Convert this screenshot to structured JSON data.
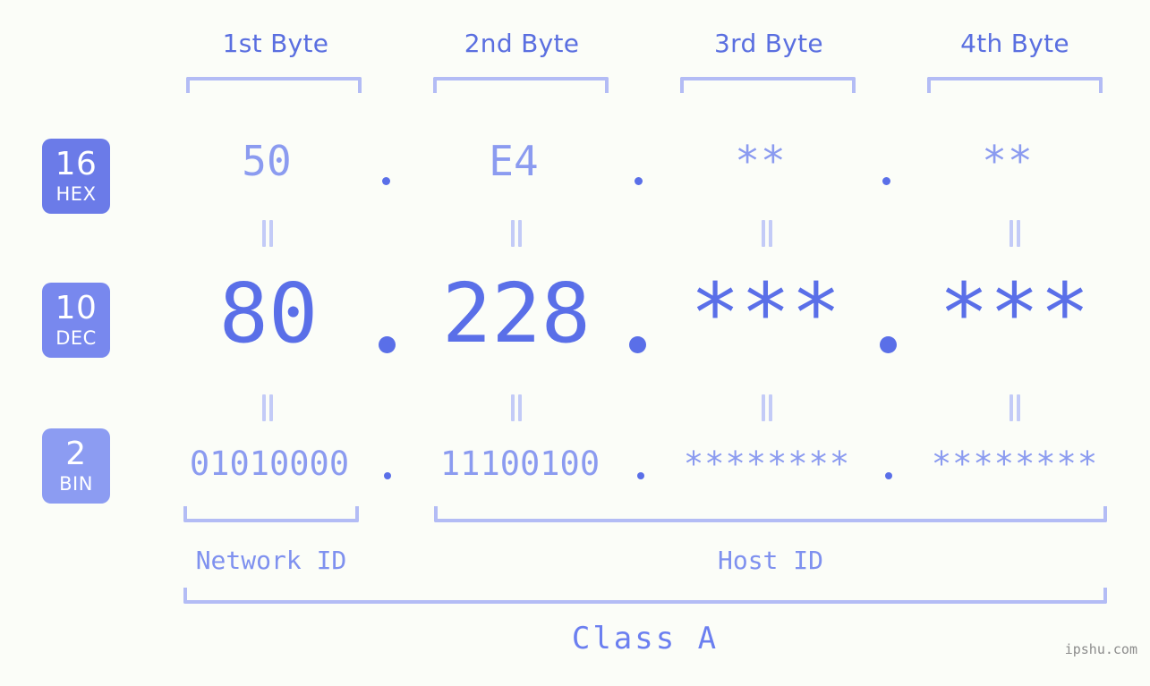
{
  "meta": {
    "background_color": "#fbfdf8",
    "accent_color": "#5a6fe8",
    "light_accent_color": "#b3bcf5",
    "badge_color": "#6b7be8",
    "badge_color_light": "#8c9cf2",
    "watermark": "ipshu.com"
  },
  "header": {
    "byte_labels": [
      {
        "label": "1st Byte"
      },
      {
        "label": "2nd Byte"
      },
      {
        "label": "3rd Byte"
      },
      {
        "label": "4th Byte"
      }
    ]
  },
  "rows": [
    {
      "key": "hex",
      "badge_number": "16",
      "badge_name": "HEX",
      "values": [
        "50",
        "E4",
        "**",
        "**"
      ],
      "separator": "."
    },
    {
      "key": "dec",
      "badge_number": "10",
      "badge_name": "DEC",
      "values": [
        "80",
        "228",
        "***",
        "***"
      ],
      "separator": "."
    },
    {
      "key": "bin",
      "badge_number": "2",
      "badge_name": "BIN",
      "values": [
        "01010000",
        "11100100",
        "********",
        "********"
      ],
      "separator": "."
    }
  ],
  "equals_marks": {
    "symbol": "||",
    "count_per_row_gap": 4
  },
  "footer": {
    "network_id_label": "Network ID",
    "host_id_label": "Host ID",
    "class_label": "Class A"
  }
}
